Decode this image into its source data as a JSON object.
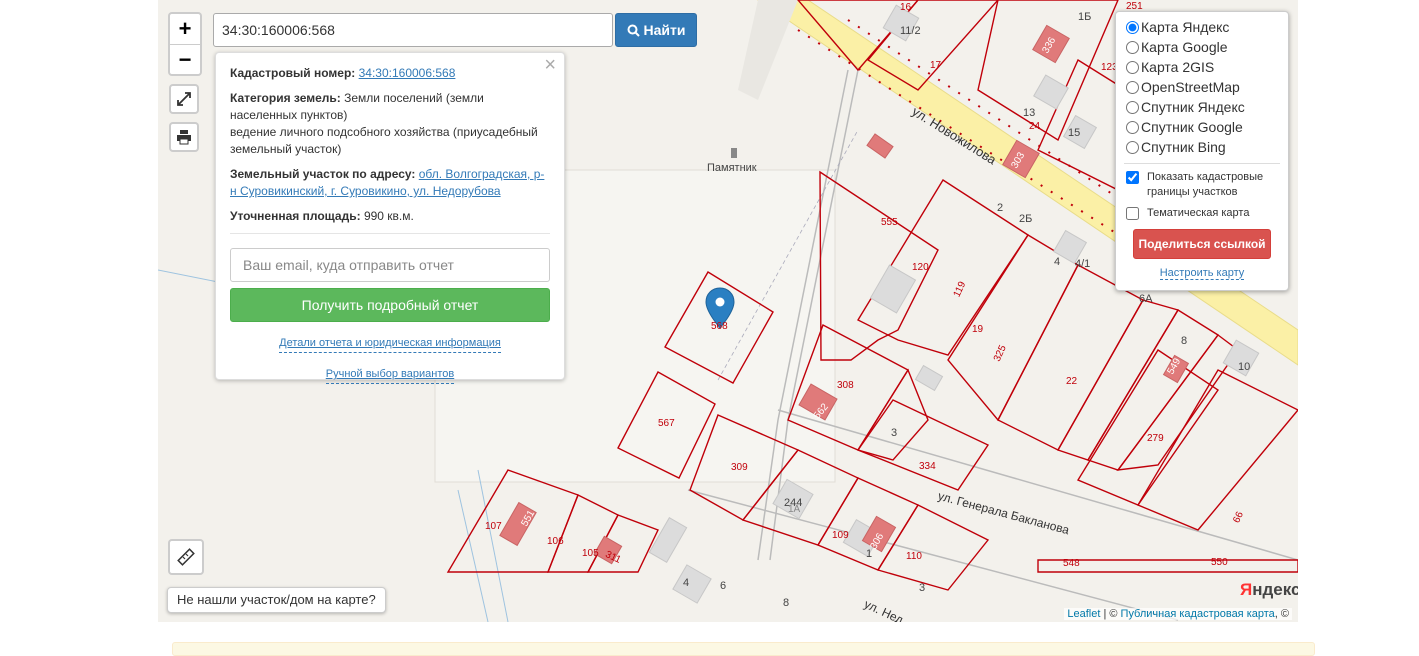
{
  "search": {
    "value": "34:30:160006:568",
    "button_label": "Найти"
  },
  "zoom": {
    "in_label": "+",
    "out_label": "−"
  },
  "info_panel": {
    "cadastral_label": "Кадастровый номер:",
    "cadastral_value": "34:30:160006:568",
    "category_label": "Категория земель:",
    "category_value": "Земли поселений (земли населенных пунктов)",
    "usage_value": "ведение личного подсобного хозяйства (приусадебный земельный участок)",
    "address_label": "Земельный участок по адресу:",
    "address_value": "обл. Волгоградская, р-н Суровикинский, г. Суровикино, ул. Недорубова",
    "area_label": "Уточненная площадь:",
    "area_value": "990 кв.м.",
    "email_placeholder": "Ваш email, куда отправить отчет",
    "report_button": "Получить подробный отчет",
    "details_link": "Детали отчета и юридическая информация",
    "manual_link": "Ручной выбор вариантов",
    "close": "×"
  },
  "layers": {
    "options": [
      "Карта Яндекс",
      "Карта Google",
      "Карта 2GIS",
      "OpenStreetMap",
      "Спутник Яндекс",
      "Спутник Google",
      "Спутник Bing"
    ],
    "selected": "Карта Яндекс",
    "show_borders_label": "Показать кадастровые границы участков",
    "show_borders_checked": true,
    "thematic_label": "Тематическая карта",
    "thematic_checked": false,
    "share_button": "Поделиться ссылкой",
    "config_link": "Настроить карту"
  },
  "not_found_button": "Не нашли участок/дом на карте?",
  "attribution": {
    "leaflet": "Leaflet",
    "sep": " | © ",
    "pkk": "Публичная кадастровая карта",
    "tail": ", ©"
  },
  "yandex_logo": {
    "first": "Я",
    "rest": "ндекс"
  },
  "map_labels": {
    "streets": [
      "ул. Новожилова",
      "ул. Генерала Бакланова",
      "ул. Нед"
    ],
    "monument": "Памятник",
    "parcels": [
      "568",
      "567",
      "555",
      "120",
      "119",
      "19",
      "325",
      "22",
      "308",
      "562",
      "3",
      "334",
      "309",
      "244",
      "109",
      "306",
      "110",
      "279",
      "549",
      "303",
      "336",
      "17",
      "107",
      "551",
      "106",
      "105",
      "311",
      "548",
      "550",
      "66",
      "8",
      "10",
      "6А",
      "4/1",
      "4",
      "2",
      "2Б",
      "13",
      "24",
      "15",
      "1Б",
      "16",
      "11/2",
      "251",
      "123",
      "1",
      "1А",
      "6",
      "4",
      "8",
      "3"
    ]
  },
  "colors": {
    "parcel_border": "#c0000a",
    "road_yellow": "#fbf0a6",
    "building": "#dcdcdc",
    "highlight_building": "#e07a7a",
    "marker": "#2a7fc2"
  }
}
